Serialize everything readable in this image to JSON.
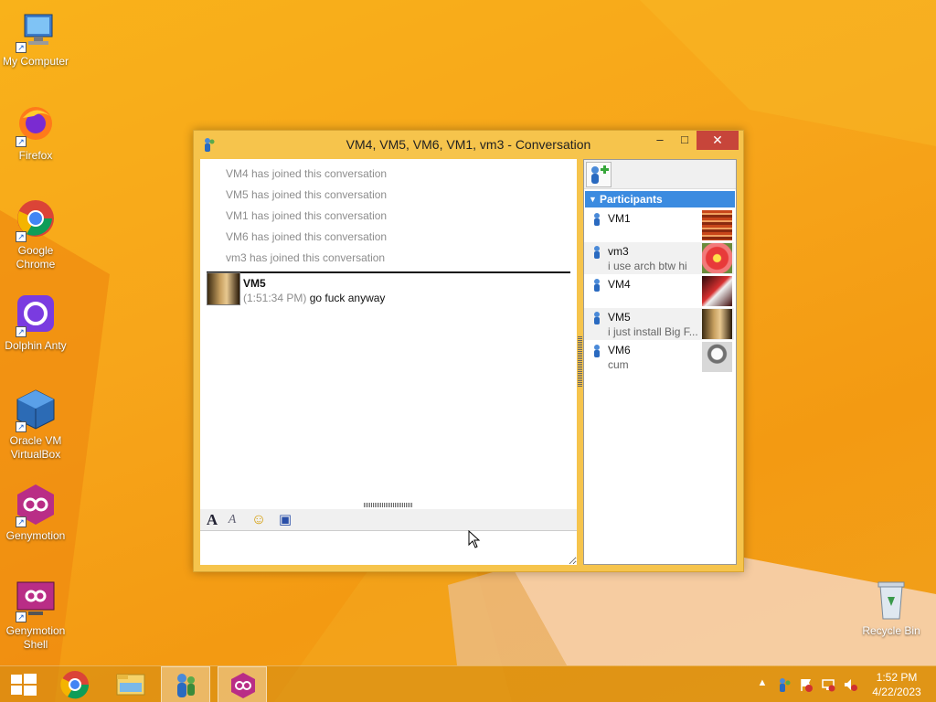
{
  "desktop": {
    "icons": [
      {
        "label": "My Computer",
        "icon": "my-computer-icon"
      },
      {
        "label": "Firefox",
        "icon": "firefox-icon"
      },
      {
        "label": "Google Chrome",
        "icon": "chrome-icon"
      },
      {
        "label": "Dolphin Anty",
        "icon": "dolphin-anty-icon"
      },
      {
        "label": "Oracle VM VirtualBox",
        "icon": "virtualbox-icon"
      },
      {
        "label": "Genymotion",
        "icon": "genymotion-icon"
      },
      {
        "label": "Genymotion Shell",
        "icon": "genymotion-shell-icon"
      },
      {
        "label": "Recycle Bin",
        "icon": "recycle-bin-icon"
      }
    ]
  },
  "window": {
    "title": "VM4, VM5, VM6, VM1, vm3 - Conversation",
    "minimize": "–",
    "maximize": "□",
    "close": "✕"
  },
  "chat": {
    "system_messages": [
      "VM4 has joined this conversation",
      "VM5 has joined this conversation",
      "VM1 has joined this conversation",
      "VM6 has joined this conversation",
      "vm3 has joined this conversation"
    ],
    "message": {
      "sender": "VM5",
      "time": "(1:51:34 PM)",
      "text": "go fuck anyway"
    },
    "input_value": ""
  },
  "toolbar": {
    "font": "A",
    "font_color": "A",
    "emoticon": "☺",
    "save": "▣"
  },
  "participants": {
    "header": "Participants",
    "list": [
      {
        "name": "VM1",
        "status": ""
      },
      {
        "name": "vm3",
        "status": "i use arch btw hi"
      },
      {
        "name": "VM4",
        "status": ""
      },
      {
        "name": "VM5",
        "status": "i just install Big F..."
      },
      {
        "name": "VM6",
        "status": "cum"
      }
    ]
  },
  "taskbar": {
    "time": "1:52 PM",
    "date": "4/22/2023"
  }
}
